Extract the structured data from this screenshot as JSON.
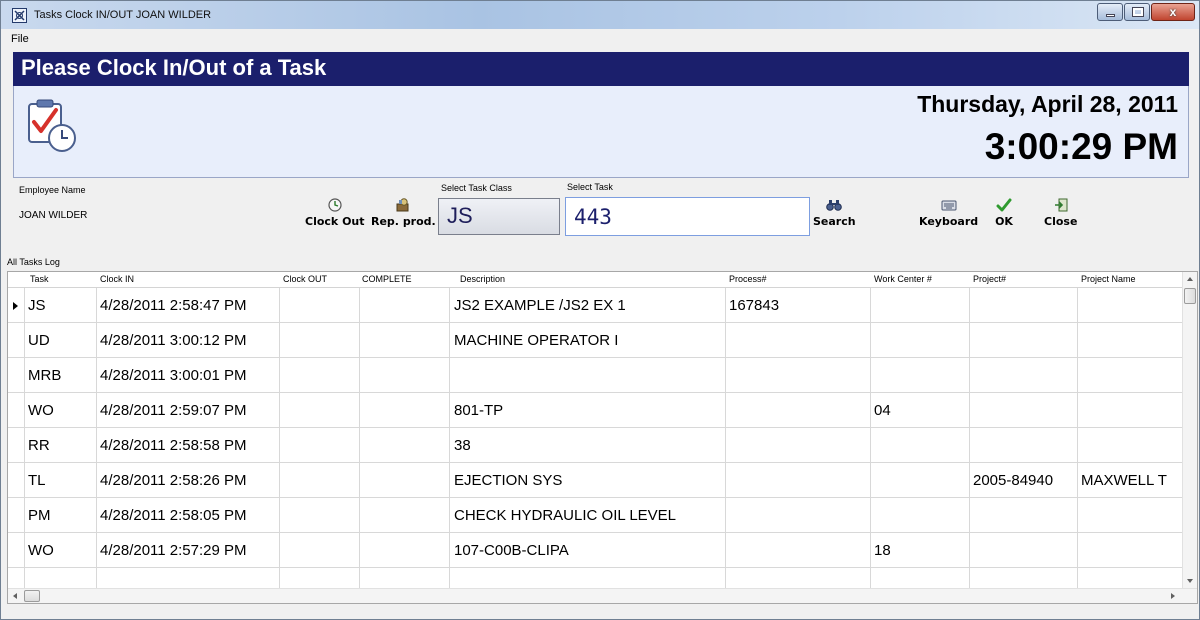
{
  "window": {
    "title": "Tasks Clock IN/OUT JOAN WILDER",
    "minimize_glyph": "",
    "close_glyph": "x"
  },
  "menu": {
    "file_label": "File"
  },
  "header": {
    "title": "Please Clock In/Out of a Task",
    "date": "Thursday, April 28, 2011",
    "time": "3:00:29 PM",
    "icon": "clipboard-clock-icon"
  },
  "employee": {
    "label": "Employee Name",
    "value": "JOAN WILDER"
  },
  "toolbar": {
    "clock_out_label": "Clock Out",
    "rep_prod_label": "Rep. prod.",
    "search_label": "Search",
    "keyboard_label": "Keyboard",
    "ok_label": "OK",
    "close_label": "Close"
  },
  "task_class": {
    "label": "Select Task Class",
    "value": "JS"
  },
  "task": {
    "label": "Select Task",
    "value": "443"
  },
  "grid": {
    "label": "All Tasks Log",
    "columns": [
      "Task",
      "Clock IN",
      "Clock OUT",
      "COMPLETE",
      "Description",
      "Process#",
      "Work Center #",
      "Project#",
      "Project Name"
    ],
    "rows": [
      [
        "JS",
        "4/28/2011 2:58:47 PM",
        "",
        "",
        "JS2 EXAMPLE /JS2 EX 1",
        "167843",
        "",
        "",
        ""
      ],
      [
        "UD",
        "4/28/2011 3:00:12 PM",
        "",
        "",
        "MACHINE OPERATOR I",
        "",
        "",
        "",
        ""
      ],
      [
        "MRB",
        "4/28/2011 3:00:01 PM",
        "",
        "",
        "",
        "",
        "",
        "",
        ""
      ],
      [
        "WO",
        "4/28/2011 2:59:07 PM",
        "",
        "",
        "801-TP",
        "",
        "04",
        "",
        ""
      ],
      [
        "RR",
        "4/28/2011 2:58:58 PM",
        "",
        "",
        "38",
        "",
        "",
        "",
        ""
      ],
      [
        "TL",
        "4/28/2011 2:58:26 PM",
        "",
        "",
        "EJECTION SYS",
        "",
        "",
        "2005-84940",
        "MAXWELL T"
      ],
      [
        "PM",
        "4/28/2011 2:58:05 PM",
        "",
        "",
        "CHECK HYDRAULIC OIL LEVEL",
        "",
        "",
        "",
        ""
      ],
      [
        "WO",
        "4/28/2011 2:57:29 PM",
        "",
        "",
        "107-C00B-CLIPA",
        "",
        "18",
        "",
        ""
      ]
    ]
  },
  "colors": {
    "header_banner": "#1b1f6c",
    "header_panel": "#e8eefb",
    "check_green": "#2f9a2f"
  }
}
